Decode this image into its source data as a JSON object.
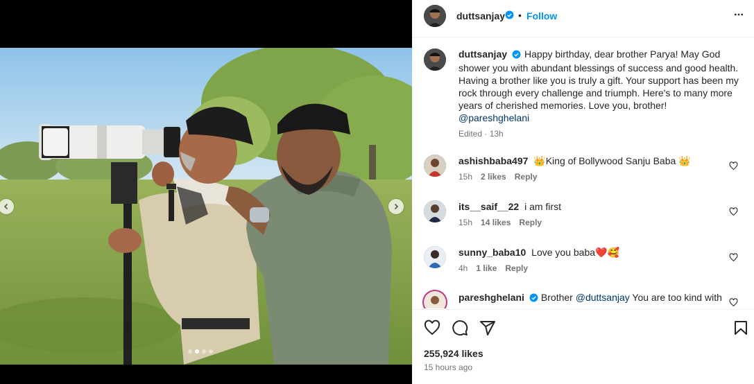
{
  "post": {
    "username": "duttsanjay",
    "follow_label": "Follow",
    "bullet": "•",
    "likes": "255,924 likes",
    "time_ago": "15 hours ago"
  },
  "caption": {
    "username": "duttsanjay",
    "text": "Happy birthday, dear brother Parya! May God shower you with abundant blessings of success and good health. Having a brother like you is truly a gift. Your support has been my rock through every challenge and triumph. Here's to many more years of cherished memories. Love you, brother!",
    "mention": "@pareshghelani",
    "meta": "Edited · 13h"
  },
  "comments": [
    {
      "username": "ashishbaba497",
      "prefix": "👑",
      "text": "King of Bollywood Sanju Baba",
      "suffix": "👑",
      "time": "15h",
      "likes": "2 likes",
      "reply": "Reply"
    },
    {
      "username": "its__saif__22",
      "prefix": "",
      "text": "i am first",
      "suffix": "",
      "time": "15h",
      "likes": "14 likes",
      "reply": "Reply"
    },
    {
      "username": "sunny_baba10",
      "prefix": "",
      "text": "Love you baba",
      "suffix": "❤️🥰",
      "time": "4h",
      "likes": "1 like",
      "reply": "Reply"
    },
    {
      "username": "pareshghelani",
      "prefix": "",
      "text": "Brother",
      "mention": "@duttsanjay",
      "text2": "You are too kind with"
    }
  ],
  "carousel": {
    "count": 4,
    "active": 1
  },
  "icons": {
    "more": "more-icon",
    "like": "heart-icon",
    "comment": "comment-icon",
    "share": "share-icon",
    "save": "bookmark-icon",
    "verified": "verified-badge-icon"
  },
  "colors": {
    "accent": "#0095f6",
    "verified": "#0095f6",
    "muted": "#737373",
    "mention": "#00376b"
  }
}
